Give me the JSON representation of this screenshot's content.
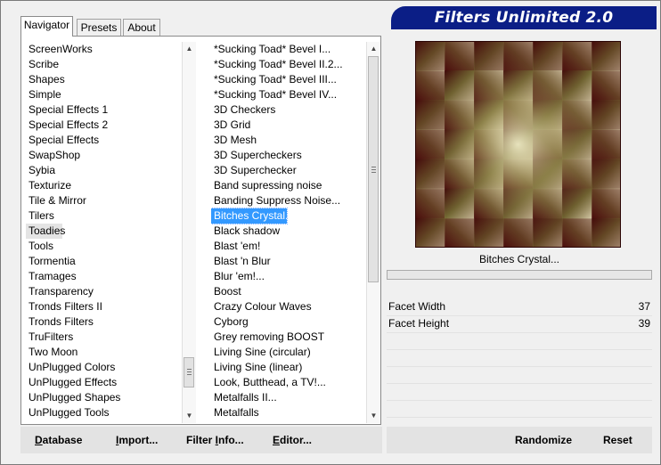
{
  "tabs": {
    "navigator": "Navigator",
    "presets": "Presets",
    "about": "About"
  },
  "banner": {
    "title": "Filters Unlimited 2.0"
  },
  "categories": [
    "ScreenWorks",
    "Scribe",
    "Shapes",
    "Simple",
    "Special Effects 1",
    "Special Effects 2",
    "Special Effects",
    "SwapShop",
    "Sybia",
    "Texturize",
    "Tile & Mirror",
    "Tilers",
    "Toadies",
    "Tools",
    "Tormentia",
    "Tramages",
    "Transparency",
    "Tronds Filters II",
    "Tronds Filters",
    "TruFilters",
    "Two Moon",
    "UnPlugged Colors",
    "UnPlugged Effects",
    "UnPlugged Shapes",
    "UnPlugged Tools"
  ],
  "selected_category": "Toadies",
  "filters": [
    "*Sucking Toad*  Bevel I...",
    "*Sucking Toad*  Bevel II.2...",
    "*Sucking Toad*  Bevel III...",
    "*Sucking Toad*  Bevel IV...",
    "3D Checkers",
    "3D Grid",
    "3D Mesh",
    "3D Supercheckers",
    "3D Superchecker",
    "Band supressing noise",
    "Banding Suppress Noise...",
    "Bitches Crystal...",
    "Black shadow",
    "Blast 'em!",
    "Blast 'n Blur",
    "Blur 'em!...",
    "Boost",
    "Crazy Colour Waves",
    "Cyborg",
    "Grey removing BOOST",
    "Living Sine (circular)",
    "Living Sine (linear)",
    "Look, Butthead, a TV!...",
    "Metalfalls II...",
    "Metalfalls"
  ],
  "selected_filter": "Bitches Crystal...",
  "preview": {
    "filter_name": "Bitches Crystal..."
  },
  "params": [
    {
      "name": "Facet Width",
      "value": "37"
    },
    {
      "name": "Facet Height",
      "value": "39"
    }
  ],
  "buttons": {
    "database": {
      "u": "D",
      "rest": "atabase"
    },
    "import": {
      "u": "I",
      "rest": "mport..."
    },
    "filter_info": {
      "pre": "Filter ",
      "u": "I",
      "rest": "nfo..."
    },
    "editor": {
      "u": "E",
      "rest": "ditor..."
    },
    "randomize": "Randomize",
    "reset": "Reset"
  },
  "colors": {
    "banner": "#0b1e86",
    "selection": "#3399ff",
    "preview_dark": "#4a0c0c",
    "preview_light": "#e8e6bd"
  }
}
